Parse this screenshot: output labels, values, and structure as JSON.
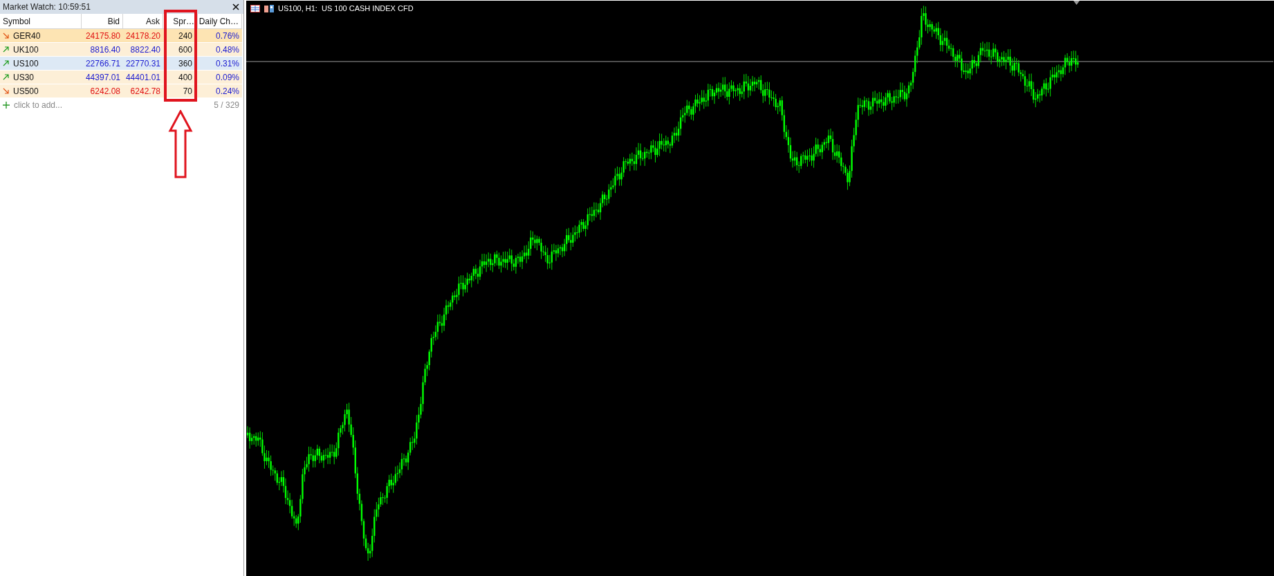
{
  "market_watch": {
    "title": "Market Watch: 10:59:51",
    "columns": [
      "Symbol",
      "Bid",
      "Ask",
      "Spr…",
      "Daily Ch…"
    ],
    "rows": [
      {
        "symbol": "GER40",
        "rising": false,
        "bid": "24175.80",
        "ask": "24178.20",
        "spread": "240",
        "daily_change": "0.76%",
        "color": "#fde4b3"
      },
      {
        "symbol": "UK100",
        "rising": true,
        "bid": "8816.40",
        "ask": "8822.40",
        "spread": "600",
        "daily_change": "0.48%",
        "color": "#fdefd7"
      },
      {
        "symbol": "US100",
        "rising": true,
        "bid": "22766.71",
        "ask": "22770.31",
        "spread": "360",
        "daily_change": "0.31%",
        "color": "#dde9f5"
      },
      {
        "symbol": "US30",
        "rising": true,
        "bid": "44397.01",
        "ask": "44401.01",
        "spread": "400",
        "daily_change": "0.09%",
        "color": "#fdefd7"
      },
      {
        "symbol": "US500",
        "rising": false,
        "bid": "6242.08",
        "ask": "6242.78",
        "spread": "70",
        "daily_change": "0.24%",
        "color": "#fdefd7"
      }
    ],
    "add_placeholder": "click to add...",
    "count": "5 / 329"
  },
  "chart": {
    "title": "US100, H1:  US 100 CASH INDEX CFD"
  }
}
